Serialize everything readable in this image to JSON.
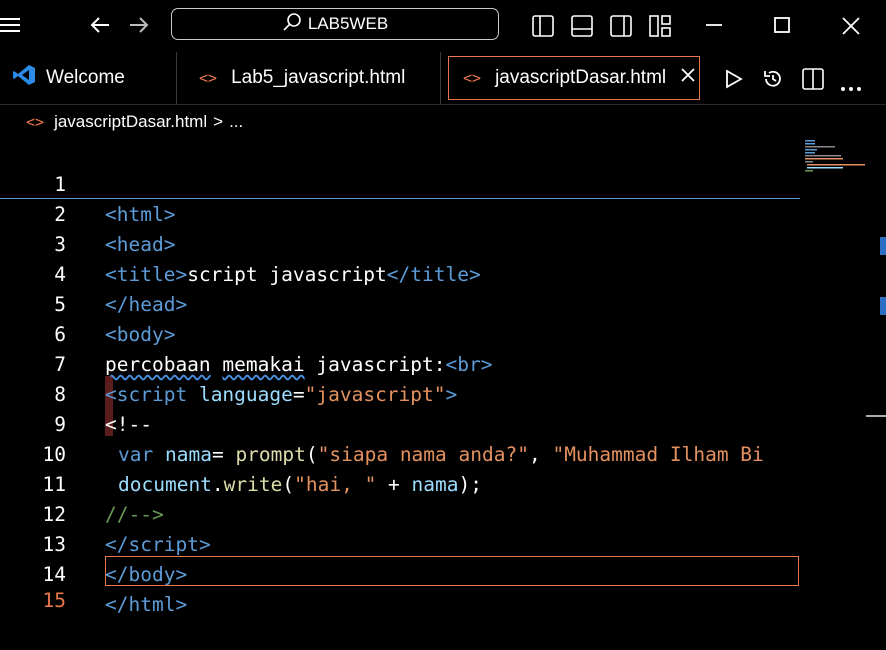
{
  "titlebar": {
    "search_text": "LAB5WEB"
  },
  "tabs": [
    {
      "label": "Welcome",
      "icon": "vscode-icon"
    },
    {
      "label": "Lab5_javascript.html",
      "icon": "code-icon"
    },
    {
      "label": "javascriptDasar.html",
      "icon": "code-icon",
      "active": true
    }
  ],
  "breadcrumb": {
    "file": "javascriptDasar.html",
    "sep": ">",
    "more": "..."
  },
  "lines": [
    "1",
    "2",
    "3",
    "4",
    "5",
    "6",
    "7",
    "8",
    "9",
    "10",
    "11",
    "12",
    "13",
    "14",
    "15"
  ],
  "code": {
    "l1": "html",
    "l2": "head",
    "l3a": "title",
    "l3b": "script javascript",
    "l4": "head",
    "l5": "body",
    "l6a": "percobaan",
    "l6b": "memakai",
    "l6c": "javascript:",
    "l6d": "br",
    "l7a": "script",
    "l7b": "language",
    "l7c": "\"javascript\"",
    "l8": "<!--",
    "l9a": "var",
    "l9b": "nama",
    "l9c": "prompt",
    "l9d": "\"siapa nama anda?\"",
    "l9e": "\"Muhammad Ilham Bi",
    "l10a": "document",
    "l10b": "write",
    "l10c": "\"hai, \"",
    "l10d": "nama",
    "l11": "//-->",
    "l12": "script",
    "l13": "body",
    "l14": "html"
  },
  "colors": {
    "accent": "#e8774a",
    "tag": "#5d9bd7",
    "string": "#e3915f",
    "comment": "#6a9955"
  }
}
